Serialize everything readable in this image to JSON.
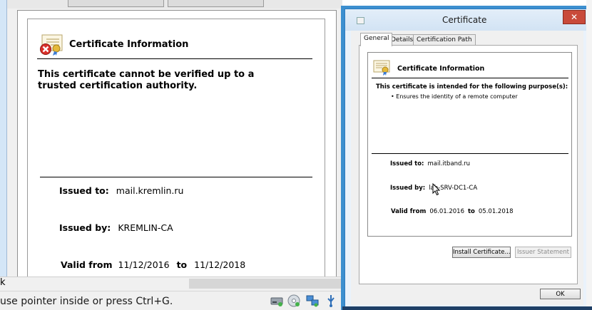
{
  "zoomed_view": {
    "title": "Certificate Information",
    "warning": "This certificate cannot be verified up to a trusted certification authority.",
    "issued_to_label": "Issued to:",
    "issued_to_value": "mail.kremlin.ru",
    "issued_by_label": "Issued by:",
    "issued_by_value": "KREMLIN-CA",
    "valid_from_label": "Valid from",
    "valid_from_value": "11/12/2016",
    "valid_to_label": "to",
    "valid_to_value": "11/12/2018"
  },
  "host_window": {
    "scroll_glyph": "k",
    "status_text": "use pointer inside or press Ctrl+G.",
    "tray_icons": [
      "hard-drive-icon",
      "cd-drive-icon",
      "network-icon",
      "usb-icon"
    ]
  },
  "dialog": {
    "title": "Certificate",
    "close_glyph": "✕",
    "tabs": [
      {
        "label": "General",
        "active": true
      },
      {
        "label": "Details",
        "active": false
      },
      {
        "label": "Certification Path",
        "active": false
      }
    ],
    "info_title": "Certificate Information",
    "purpose_heading": "This certificate is intended for the following purpose(s):",
    "purposes": [
      "Ensures the identity of a remote computer"
    ],
    "issued_to_label": "Issued to:",
    "issued_to_value": "mail.itband.ru",
    "issued_by_label": "Issued by:",
    "issued_by_value": "lab-SRV-DC1-CA",
    "valid_from_label": "Valid from",
    "valid_from_value": "06.01.2016",
    "valid_to_label": "to",
    "valid_to_value": "05.01.2018",
    "install_button": "Install Certificate...",
    "issuer_button": "Issuer Statement",
    "ok_button": "OK"
  },
  "colors": {
    "dialog_border": "#3c8fcf",
    "close_button": "#c94a3a",
    "error_badge": "#d9302a"
  }
}
